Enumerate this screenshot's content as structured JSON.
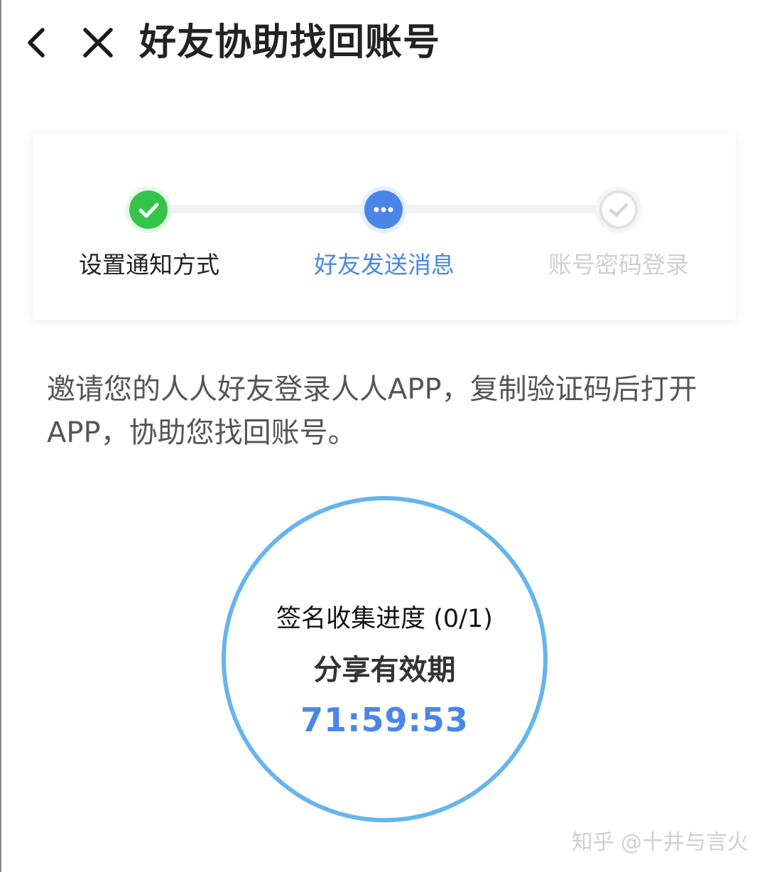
{
  "header": {
    "title": "好友协助找回账号",
    "back_icon": "chevron-left-icon",
    "close_icon": "close-icon"
  },
  "steps": [
    {
      "label": "设置通知方式",
      "status": "done",
      "icon": "check-circle-icon",
      "color": "#34c449"
    },
    {
      "label": "好友发送消息",
      "status": "current",
      "icon": "more-dots-icon",
      "color": "#4a86e8"
    },
    {
      "label": "账号密码登录",
      "status": "pending",
      "icon": "check-outline-icon",
      "color": "#d0d0d0"
    }
  ],
  "description": "邀请您的人人好友登录人人APP，复制验证码后打开APP，协助您找回账号。",
  "progress": {
    "collect_label": "签名收集进度 (0/1)",
    "share_title": "分享有效期",
    "countdown": "71:59:53",
    "ring_color": "#67b4ee"
  },
  "watermark": "知乎 @十井与言火"
}
